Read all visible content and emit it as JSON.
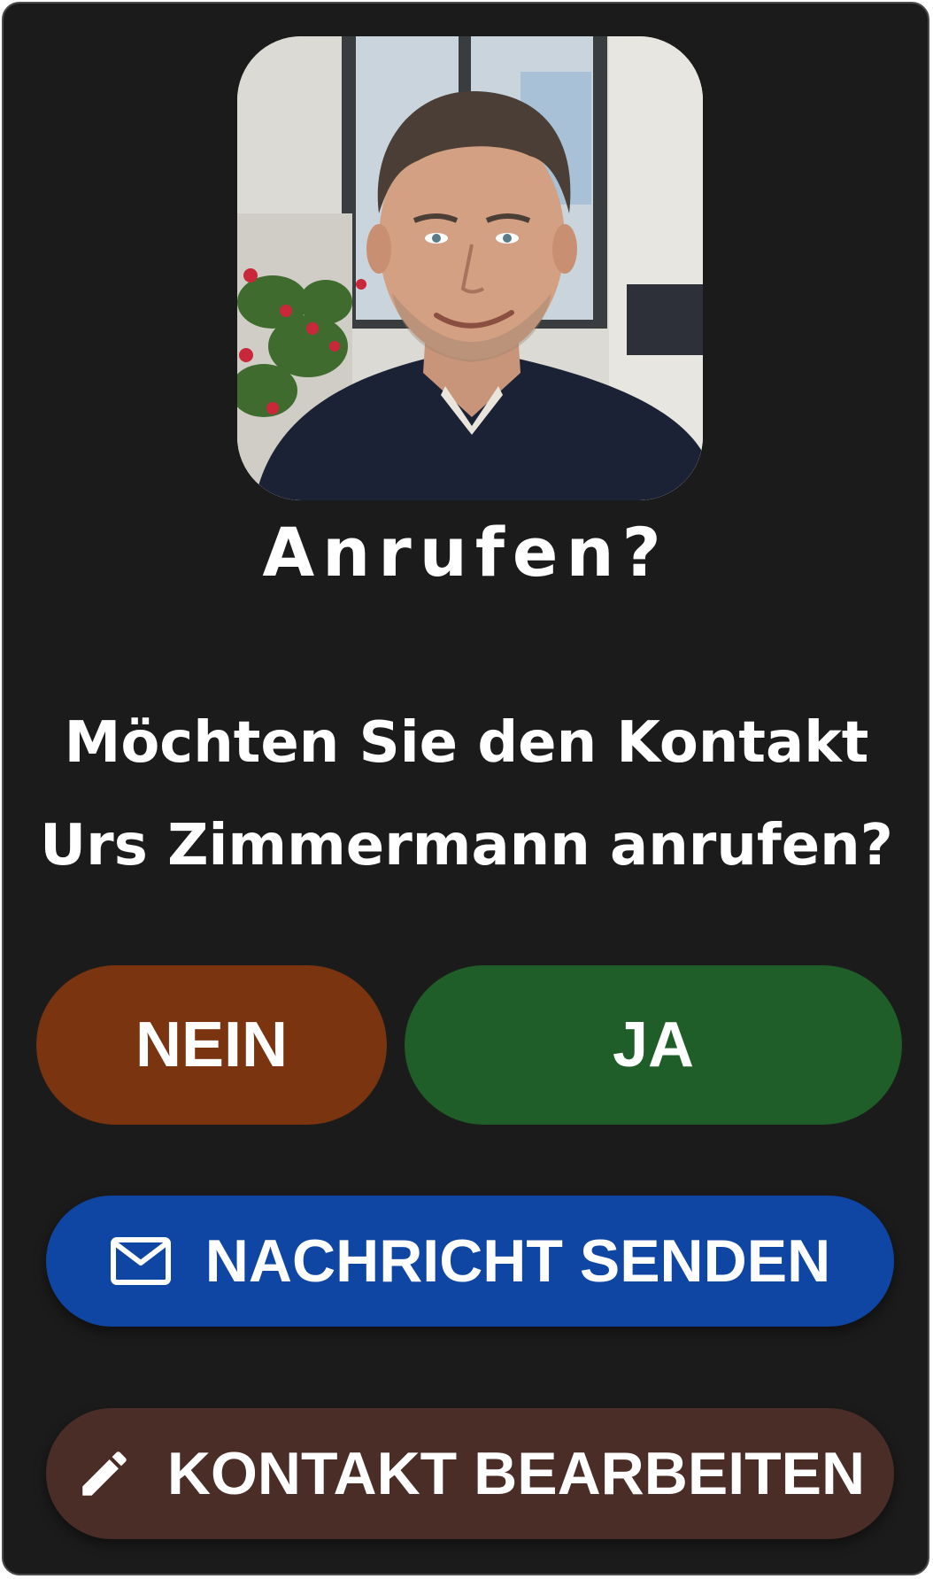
{
  "dialog": {
    "title": "Anrufen?",
    "question_line1": "Möchten Sie den Kontakt",
    "question_line2": "Urs Zimmermann anrufen?",
    "contact_photo_alt": "Urs Zimmermann"
  },
  "buttons": {
    "no_label": "NEIN",
    "yes_label": "JA",
    "message_label": "NACHRICHT SENDEN",
    "message_icon": "mail-icon",
    "edit_label": "KONTAKT BEARBEITEN",
    "edit_icon": "pencil-icon"
  },
  "colors": {
    "background": "#1b1b1b",
    "no": "#7a3510",
    "yes": "#1f5e29",
    "message": "#0f46a3",
    "edit": "#4b2d27",
    "text": "#ffffff"
  }
}
